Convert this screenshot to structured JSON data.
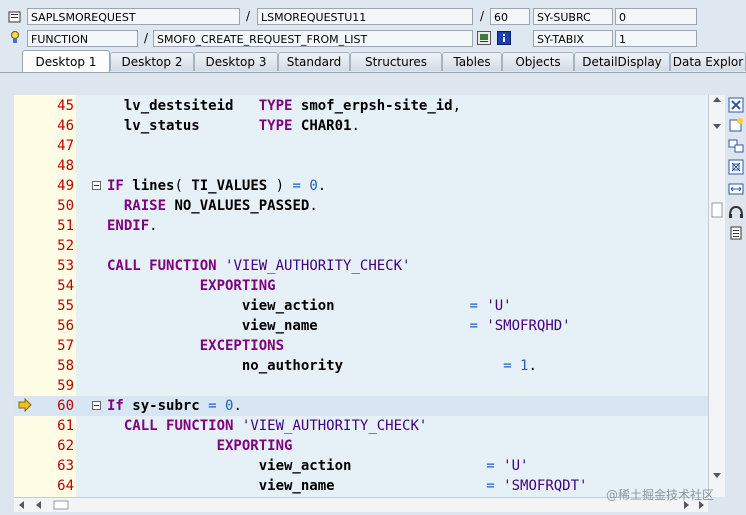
{
  "info": {
    "program": "SAPLSMOREQUEST",
    "include": "LSMOREQUESTU11",
    "line_no": "60",
    "var1_name": "SY-SUBRC",
    "var1_value": "0",
    "type": "FUNCTION",
    "object": "SMOF0_CREATE_REQUEST_FROM_LIST",
    "var2_name": "SY-TABIX",
    "var2_value": "1"
  },
  "tabs": [
    "Desktop 1",
    "Desktop 2",
    "Desktop 3",
    "Standard",
    "Structures",
    "Tables",
    "Objects",
    "DetailDisplay",
    "Data Explor"
  ],
  "code": {
    "lines": [
      {
        "n": "45",
        "t": "  lv_destsiteid   TYPE smof_erpsh-site_id,"
      },
      {
        "n": "46",
        "t": "  lv_status       TYPE CHAR01."
      },
      {
        "n": "47",
        "t": ""
      },
      {
        "n": "48",
        "t": ""
      },
      {
        "n": "49",
        "t": "IF lines( TI_VALUES ) = 0."
      },
      {
        "n": "50",
        "t": "  RAISE NO_VALUES_PASSED."
      },
      {
        "n": "51",
        "t": "ENDIF."
      },
      {
        "n": "52",
        "t": ""
      },
      {
        "n": "53",
        "t": "CALL FUNCTION 'VIEW_AUTHORITY_CHECK'"
      },
      {
        "n": "54",
        "t": "           EXPORTING"
      },
      {
        "n": "55",
        "t": "                view_action                = 'U'"
      },
      {
        "n": "56",
        "t": "                view_name                  = 'SMOFRQHD'"
      },
      {
        "n": "57",
        "t": "           EXCEPTIONS"
      },
      {
        "n": "58",
        "t": "                no_authority                   = 1."
      },
      {
        "n": "59",
        "t": ""
      },
      {
        "n": "60",
        "t": "If sy-subrc = 0."
      },
      {
        "n": "61",
        "t": "  CALL FUNCTION 'VIEW_AUTHORITY_CHECK'"
      },
      {
        "n": "62",
        "t": "             EXPORTING"
      },
      {
        "n": "63",
        "t": "                  view_action                = 'U'"
      },
      {
        "n": "64",
        "t": "                  view_name                  = 'SMOFRQDT'"
      }
    ]
  },
  "watermark": "@稀土掘金技术社区",
  "colors": {
    "keyword": "#800080",
    "line_number": "#c00000",
    "number": "#2060c0",
    "current_line": "#d8e6f3"
  }
}
